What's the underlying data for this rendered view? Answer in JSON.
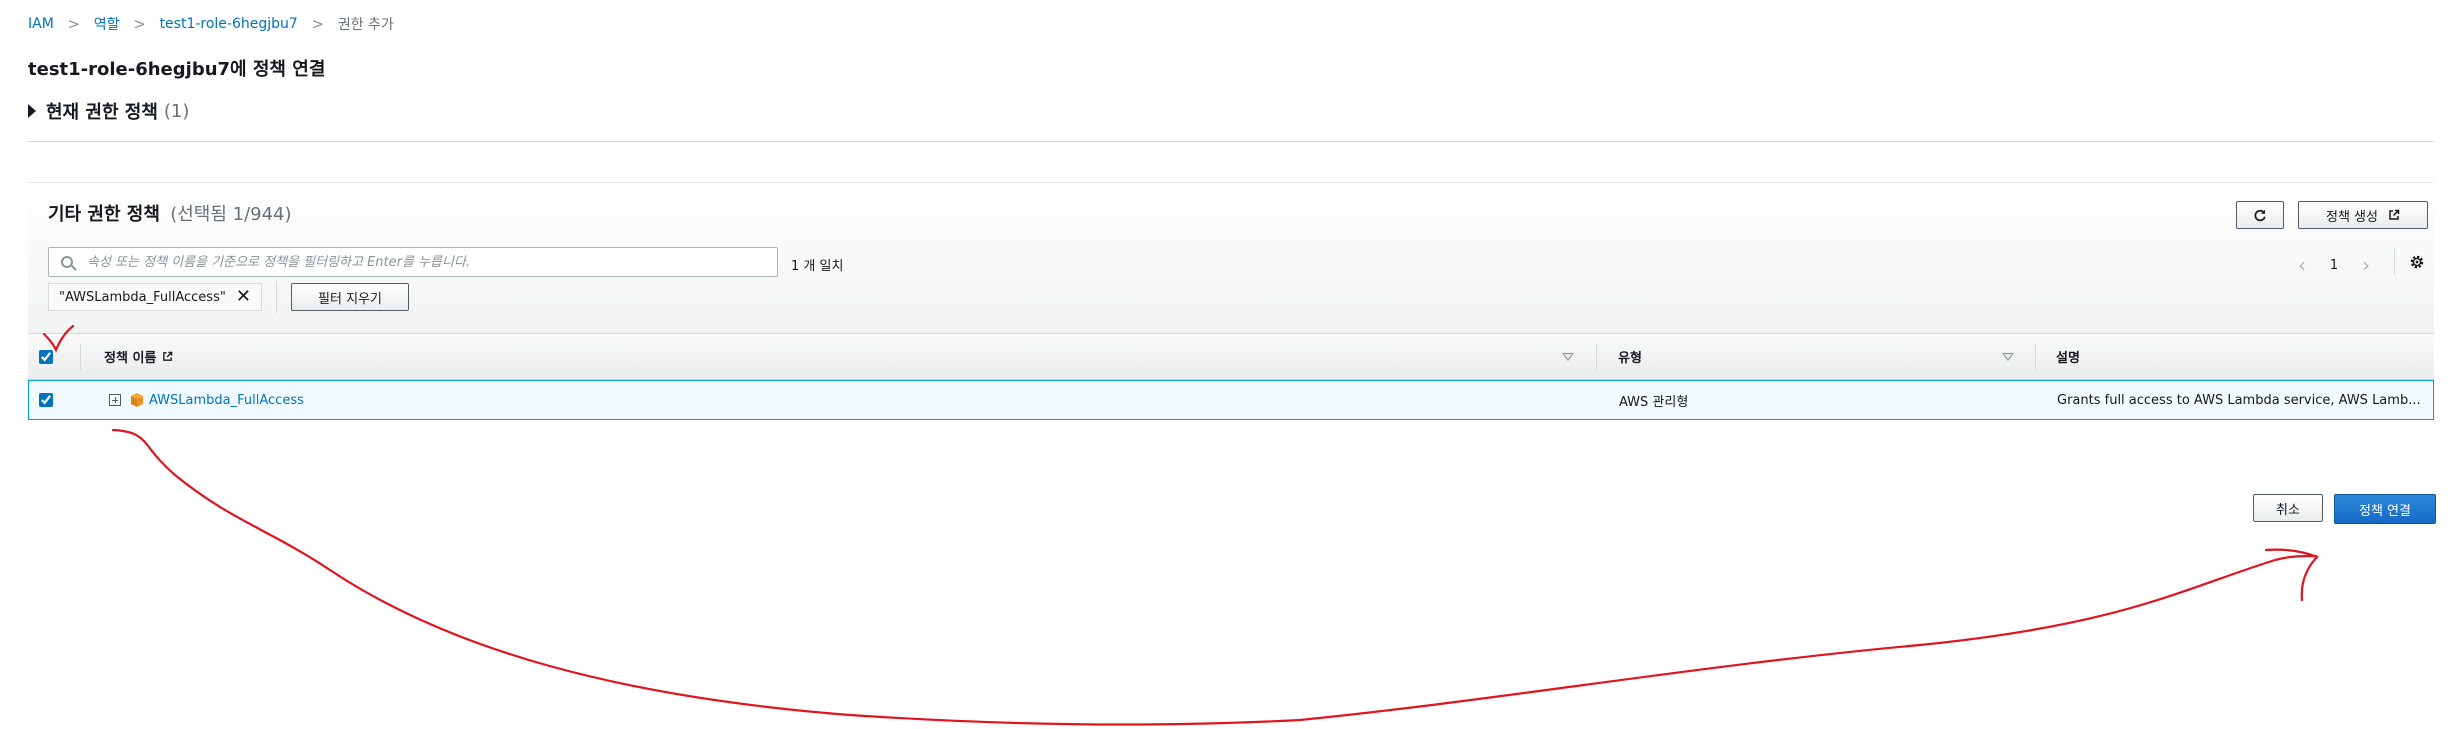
{
  "breadcrumb": {
    "items": [
      "IAM",
      "역할",
      "test1-role-6hegjbu7"
    ],
    "current": "권한 추가",
    "separator": ">"
  },
  "page_title": "test1-role-6hegjbu7에 정책 연결",
  "current_permissions": {
    "label": "현재 권한 정책",
    "count": "(1)"
  },
  "policies_panel": {
    "title": "기타 권한 정책",
    "selected_count": "(선택됨 1/944)",
    "refresh_icon": "refresh-icon",
    "create_button": "정책 생성",
    "search": {
      "placeholder": "속성 또는 정책 이름을 기준으로 정책을 필터링하고 Enter를 누릅니다.",
      "value": ""
    },
    "match_count": "1 개 일치",
    "pagination": {
      "prev": "‹",
      "page": "1",
      "next": "›"
    },
    "filter_token": "\"AWSLambda_FullAccess\"",
    "clear_filters_button": "필터 지우기",
    "table": {
      "columns": [
        "정책 이름",
        "유형",
        "설명"
      ],
      "rows": [
        {
          "selected": true,
          "name": "AWSLambda_FullAccess",
          "type": "AWS 관리형",
          "description": "Grants full access to AWS Lambda service, AWS Lamb..."
        }
      ]
    }
  },
  "footer": {
    "cancel_button": "취소",
    "attach_button": "정책 연결"
  },
  "colors": {
    "link": "#0073bb",
    "primary": "#1569c7",
    "selected_row_bg": "#f1faff",
    "selected_row_border": "#00a1c9",
    "annotation": "#e0141e"
  }
}
